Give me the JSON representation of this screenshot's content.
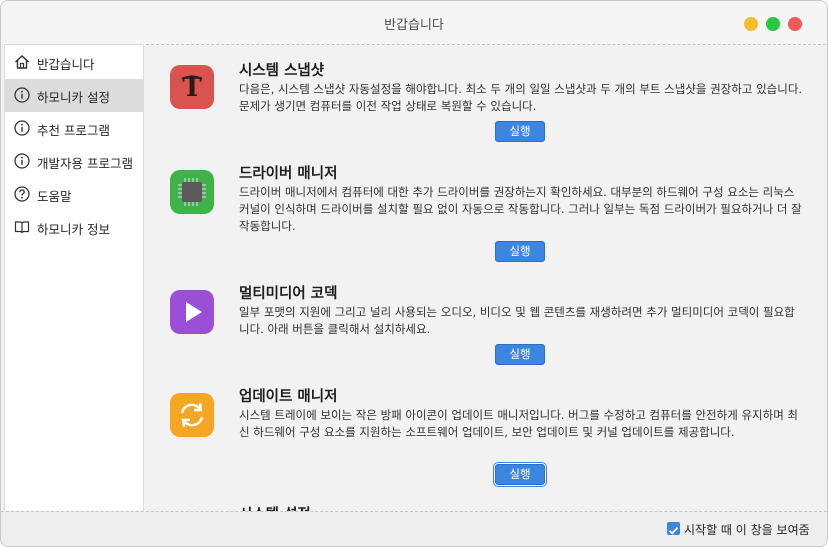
{
  "window": {
    "title": "반갑습니다"
  },
  "sidebar": {
    "items": [
      {
        "label": "반갑습니다",
        "icon": "home-icon"
      },
      {
        "label": "하모니카 설정",
        "icon": "info-icon",
        "active": true
      },
      {
        "label": "추천 프로그램",
        "icon": "info-icon"
      },
      {
        "label": "개발자용 프로그램",
        "icon": "info-icon"
      },
      {
        "label": "도움말",
        "icon": "help-icon"
      },
      {
        "label": "하모니카 정보",
        "icon": "book-icon"
      }
    ]
  },
  "sections": [
    {
      "title": "시스템 스냅샷",
      "description": "다음은, 시스템 스냅샷 자동설정을 해야합니다. 최소 두 개의 일일 스냅샷과 두 개의 부트 스냅샷을 권장하고 있습니다. 문제가 생기면 컴퓨터를 이전 작업 상태로 복원할 수 있습니다.",
      "button": "실행",
      "icon": "timeshift-icon",
      "icon_color": "#d9534f"
    },
    {
      "title": "드라이버 매니저",
      "description": "드라이버 매니저에서 컴퓨터에 대한 추가 드라이버를 권장하는지 확인하세요. 대부분의 하드웨어 구성 요소는 리눅스 커널이 인식하며 드라이버를 설치할 필요 없이 자동으로 작동합니다. 그러나 일부는 독점 드라이버가 필요하거나 더 잘 작동합니다.",
      "button": "실행",
      "icon": "chip-icon",
      "icon_color": "#3db34a"
    },
    {
      "title": "멀티미디어 코덱",
      "description": "일부 포맷의 지원에 그리고 널리 사용되는 오디오, 비디오 및 웹 콘텐츠를 재생하려면 추가 멀티미디어 코덱이 필요합니다. 아래 버튼을 클릭해서 설치하세요.",
      "button": "실행",
      "icon": "play-icon",
      "icon_color": "#9b4fd6"
    },
    {
      "title": "업데이트 매니저",
      "description": "시스템 트레이에 보이는 작은 방패 아이콘이 업데이트 매니저입니다. 버그를 수정하고 컴퓨터를 안전하게 유지하며 최신 하드웨어 구성 요소를 지원하는 소프트웨어 업데이트, 보안 업데이트 및 커널 업데이트를 제공합니다.",
      "button": "실행",
      "icon": "refresh-icon",
      "icon_color": "#f5a623"
    },
    {
      "title": "시스템 설정"
    }
  ],
  "footer": {
    "show_on_startup_label": "시작할 때 이 창을 보여줌",
    "show_on_startup_checked": true
  }
}
